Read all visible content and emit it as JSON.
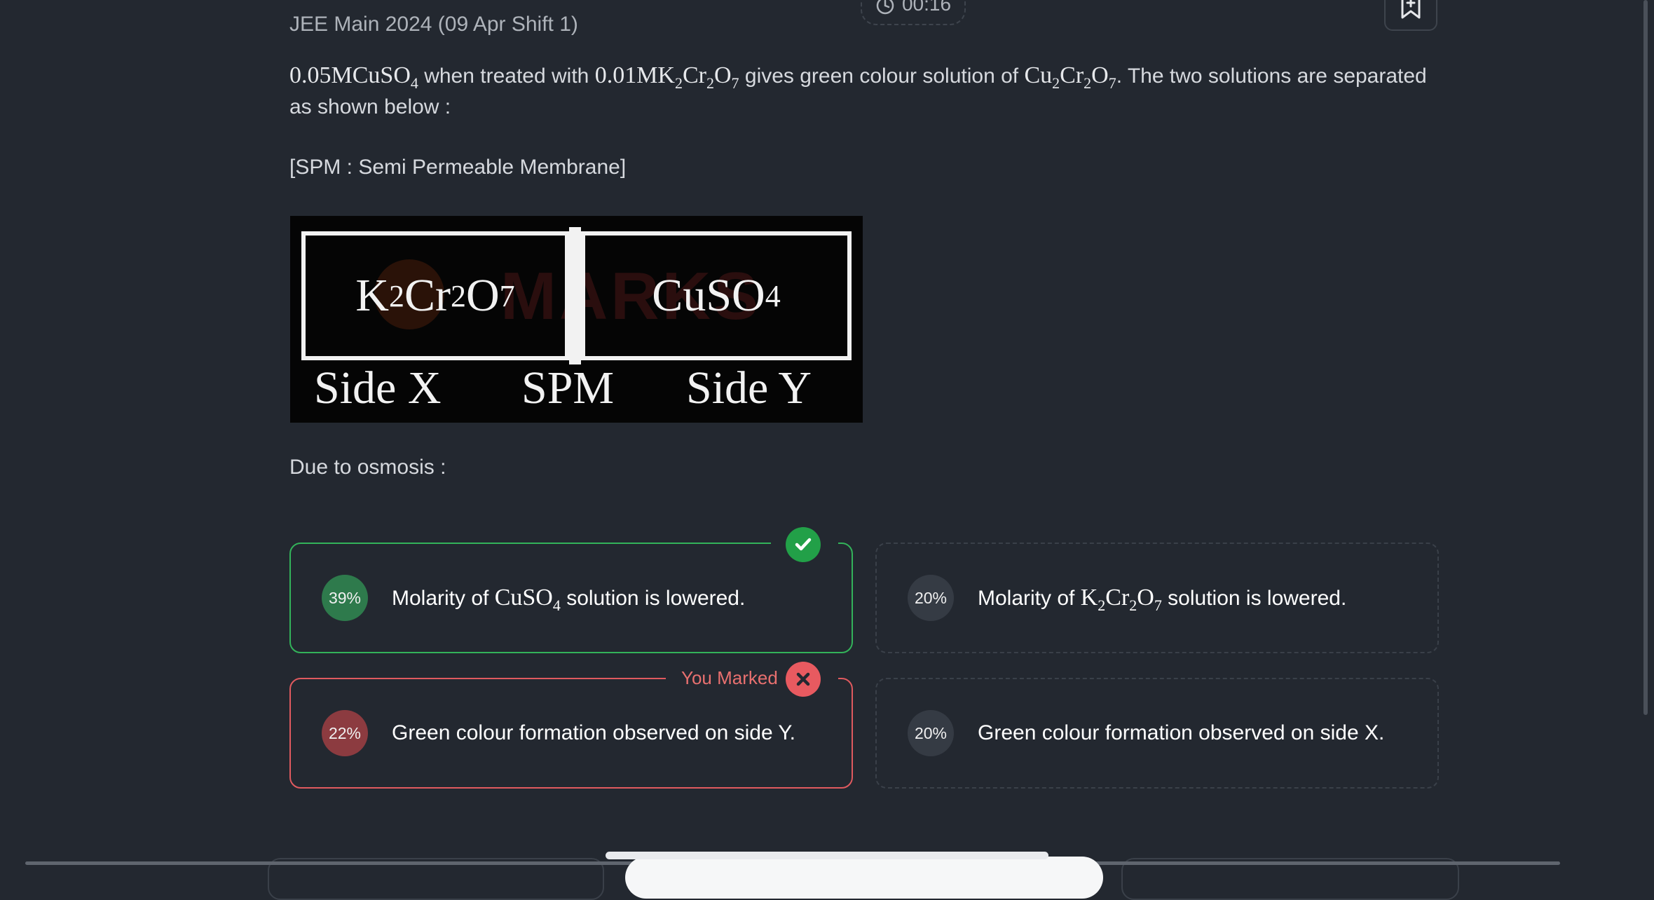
{
  "header": {
    "exam_label": "JEE Main 2024 (09 Apr Shift 1)",
    "timer": "00:16",
    "timer_icon": "clock-icon",
    "bookmark_icon": "bookmark-plus-icon"
  },
  "question": {
    "m1": "0.05MCuSO",
    "m1_sub": "4",
    "t1": " when treated with ",
    "m2": "0.01MK",
    "m2_s1": "2",
    "m2_b": "Cr",
    "m2_s2": "2",
    "m2_c": "O",
    "m2_s3": "7",
    "t2": " gives green colour solution of ",
    "m3": "Cu",
    "m3_s1": "2",
    "m3_b": "Cr",
    "m3_s2": "2",
    "m3_c": "O",
    "m3_s3": "7",
    "t3": ". The two solutions are separated as shown below :",
    "spm_note": "[SPM : Semi Permeable Membrane]",
    "osmosis": "Due to osmosis :"
  },
  "diagram": {
    "left_a": "K",
    "left_s1": "2",
    "left_b": "Cr",
    "left_s2": "2",
    "left_c": "O",
    "left_s3": "7",
    "right_a": "CuSO",
    "right_s1": "4",
    "side_x": "Side X",
    "spm": "SPM",
    "side_y": "Side Y",
    "watermark": "MARKS"
  },
  "options": [
    {
      "percent": "39%",
      "text_a": "Molarity of ",
      "formula": "CuSO",
      "formula_sub": "4",
      "text_b": " solution is lowered.",
      "status": "correct"
    },
    {
      "percent": "20%",
      "text_a": "Molarity of ",
      "f_a": "K",
      "f_s1": "2",
      "f_b": "Cr",
      "f_s2": "2",
      "f_c": "O",
      "f_s3": "7",
      "text_b": " solution is lowered.",
      "status": "neutral"
    },
    {
      "percent": "22%",
      "text": "Green colour formation observed on side Y.",
      "status": "wrong",
      "marked_label": "You Marked"
    },
    {
      "percent": "20%",
      "text": "Green colour formation observed on side X.",
      "status": "neutral"
    }
  ],
  "colors": {
    "background": "#232830",
    "correct": "#33b35a",
    "wrong": "#e05a5f"
  }
}
